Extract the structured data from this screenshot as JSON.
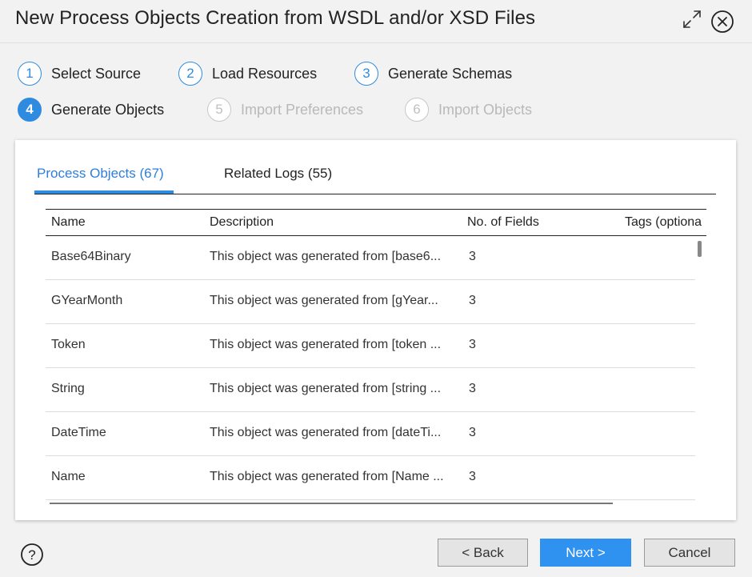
{
  "dialog": {
    "title": "New Process Objects Creation from WSDL and/or XSD Files",
    "icons": [
      "expand-icon",
      "close-icon",
      "help-icon"
    ]
  },
  "steps": [
    {
      "num": "1",
      "label": "Select Source",
      "state": "done"
    },
    {
      "num": "2",
      "label": "Load Resources",
      "state": "done"
    },
    {
      "num": "3",
      "label": "Generate Schemas",
      "state": "done"
    },
    {
      "num": "4",
      "label": "Generate Objects",
      "state": "active"
    },
    {
      "num": "5",
      "label": "Import Preferences",
      "state": "disabled"
    },
    {
      "num": "6",
      "label": "Import Objects",
      "state": "disabled"
    }
  ],
  "tabs": [
    {
      "label": "Process Objects (67)",
      "active": true
    },
    {
      "label": "Related Logs (55)",
      "active": false
    }
  ],
  "table": {
    "columns": [
      "Name",
      "Description",
      "No. of Fields",
      "Tags (optiona"
    ],
    "rows": [
      {
        "name": "Base64Binary",
        "description": "This object was generated from [base6...",
        "fields": "3",
        "tags": ""
      },
      {
        "name": "GYearMonth",
        "description": "This object was generated from [gYear...",
        "fields": "3",
        "tags": ""
      },
      {
        "name": "Token",
        "description": "This object was generated from [token ...",
        "fields": "3",
        "tags": ""
      },
      {
        "name": "String",
        "description": "This object was generated from [string ...",
        "fields": "3",
        "tags": ""
      },
      {
        "name": "DateTime",
        "description": "This object was generated from [dateTi...",
        "fields": "3",
        "tags": ""
      },
      {
        "name": "Name",
        "description": "This object was generated from [Name ...",
        "fields": "3",
        "tags": ""
      }
    ]
  },
  "buttons": {
    "back": "< Back",
    "next": "Next >",
    "cancel": "Cancel"
  },
  "colors": {
    "accent": "#2f8be0",
    "primary_button": "#2f91f0",
    "disabled_text": "#b9b9b9"
  }
}
